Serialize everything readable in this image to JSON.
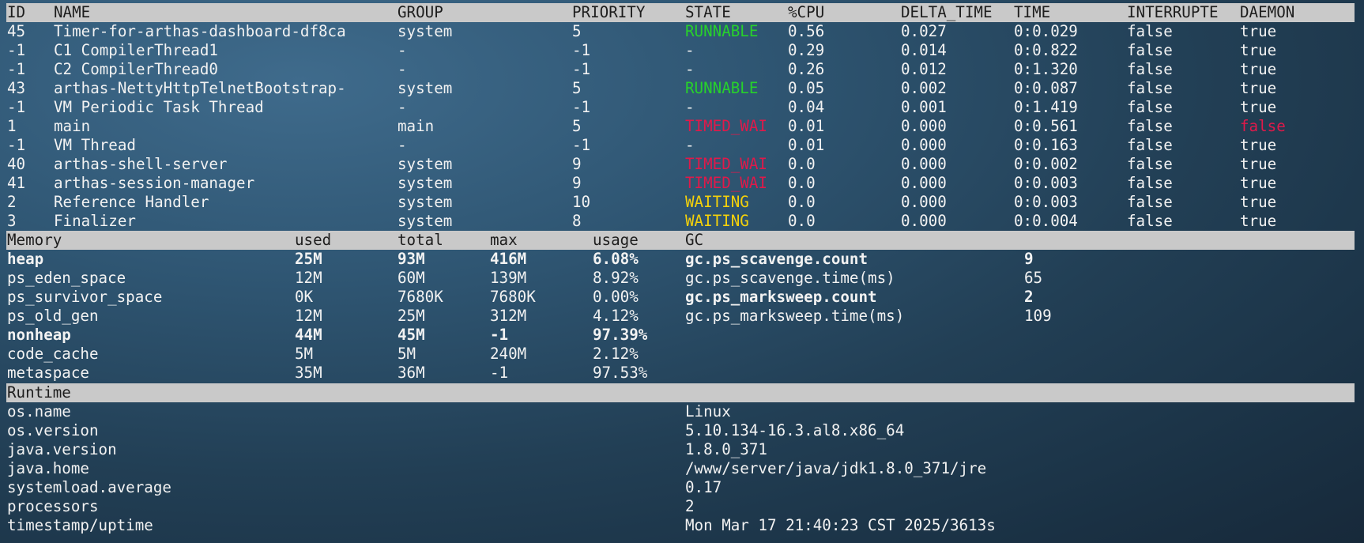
{
  "threads": {
    "headers": {
      "id": "ID",
      "name": "NAME",
      "group": "GROUP",
      "priority": "PRIORITY",
      "state": "STATE",
      "cpu": "%CPU",
      "delta_time": "DELTA_TIME",
      "time": "TIME",
      "interrupted": "INTERRUPTE",
      "daemon": "DAEMON"
    },
    "rows": [
      {
        "id": "45",
        "name": "Timer-for-arthas-dashboard-df8ca",
        "group": "system",
        "priority": "5",
        "state": "RUNNABLE",
        "cpu": "0.56",
        "delta_time": "0.027",
        "time": "0:0.029",
        "interrupted": "false",
        "daemon": "true"
      },
      {
        "id": "-1",
        "name": "C1 CompilerThread1",
        "group": "-",
        "priority": "-1",
        "state": "-",
        "cpu": "0.29",
        "delta_time": "0.014",
        "time": "0:0.822",
        "interrupted": "false",
        "daemon": "true"
      },
      {
        "id": "-1",
        "name": "C2 CompilerThread0",
        "group": "-",
        "priority": "-1",
        "state": "-",
        "cpu": "0.26",
        "delta_time": "0.012",
        "time": "0:1.320",
        "interrupted": "false",
        "daemon": "true"
      },
      {
        "id": "43",
        "name": "arthas-NettyHttpTelnetBootstrap-",
        "group": "system",
        "priority": "5",
        "state": "RUNNABLE",
        "cpu": "0.05",
        "delta_time": "0.002",
        "time": "0:0.087",
        "interrupted": "false",
        "daemon": "true"
      },
      {
        "id": "-1",
        "name": "VM Periodic Task Thread",
        "group": "-",
        "priority": "-1",
        "state": "-",
        "cpu": "0.04",
        "delta_time": "0.001",
        "time": "0:1.419",
        "interrupted": "false",
        "daemon": "true"
      },
      {
        "id": "1",
        "name": "main",
        "group": "main",
        "priority": "5",
        "state": "TIMED_WAI",
        "cpu": "0.01",
        "delta_time": "0.000",
        "time": "0:0.561",
        "interrupted": "false",
        "daemon": "false"
      },
      {
        "id": "-1",
        "name": "VM Thread",
        "group": "-",
        "priority": "-1",
        "state": "-",
        "cpu": "0.01",
        "delta_time": "0.000",
        "time": "0:0.163",
        "interrupted": "false",
        "daemon": "true"
      },
      {
        "id": "40",
        "name": "arthas-shell-server",
        "group": "system",
        "priority": "9",
        "state": "TIMED_WAI",
        "cpu": "0.0",
        "delta_time": "0.000",
        "time": "0:0.002",
        "interrupted": "false",
        "daemon": "true"
      },
      {
        "id": "41",
        "name": "arthas-session-manager",
        "group": "system",
        "priority": "9",
        "state": "TIMED_WAI",
        "cpu": "0.0",
        "delta_time": "0.000",
        "time": "0:0.003",
        "interrupted": "false",
        "daemon": "true"
      },
      {
        "id": "2",
        "name": "Reference Handler",
        "group": "system",
        "priority": "10",
        "state": "WAITING",
        "cpu": "0.0",
        "delta_time": "0.000",
        "time": "0:0.003",
        "interrupted": "false",
        "daemon": "true"
      },
      {
        "id": "3",
        "name": "Finalizer",
        "group": "system",
        "priority": "8",
        "state": "WAITING",
        "cpu": "0.0",
        "delta_time": "0.000",
        "time": "0:0.004",
        "interrupted": "false",
        "daemon": "true"
      }
    ]
  },
  "memory": {
    "headers": {
      "name": "Memory",
      "used": "used",
      "total": "total",
      "max": "max",
      "usage": "usage",
      "gc": "GC"
    },
    "rows": [
      {
        "name": "heap",
        "used": "25M",
        "total": "93M",
        "max": "416M",
        "usage": "6.08%",
        "bold": true
      },
      {
        "name": "ps_eden_space",
        "used": "12M",
        "total": "60M",
        "max": "139M",
        "usage": "8.92%",
        "bold": false
      },
      {
        "name": "ps_survivor_space",
        "used": "0K",
        "total": "7680K",
        "max": "7680K",
        "usage": "0.00%",
        "bold": false
      },
      {
        "name": "ps_old_gen",
        "used": "12M",
        "total": "25M",
        "max": "312M",
        "usage": "4.12%",
        "bold": false
      },
      {
        "name": "nonheap",
        "used": "44M",
        "total": "45M",
        "max": "-1",
        "usage": "97.39%",
        "bold": true
      },
      {
        "name": "code_cache",
        "used": "5M",
        "total": "5M",
        "max": "240M",
        "usage": "2.12%",
        "bold": false
      },
      {
        "name": "metaspace",
        "used": "35M",
        "total": "36M",
        "max": "-1",
        "usage": "97.53%",
        "bold": false
      }
    ],
    "gc": [
      {
        "name": "gc.ps_scavenge.count",
        "value": "9",
        "bold": true
      },
      {
        "name": "gc.ps_scavenge.time(ms)",
        "value": "65",
        "bold": false
      },
      {
        "name": "gc.ps_marksweep.count",
        "value": "2",
        "bold": true
      },
      {
        "name": "gc.ps_marksweep.time(ms)",
        "value": "109",
        "bold": false
      }
    ]
  },
  "runtime": {
    "header": "Runtime",
    "rows": [
      {
        "key": "os.name",
        "value": "Linux"
      },
      {
        "key": "os.version",
        "value": "5.10.134-16.3.al8.x86_64"
      },
      {
        "key": "java.version",
        "value": "1.8.0_371"
      },
      {
        "key": "java.home",
        "value": "/www/server/java/jdk1.8.0_371/jre"
      },
      {
        "key": "systemload.average",
        "value": "0.17"
      },
      {
        "key": "processors",
        "value": "2"
      },
      {
        "key": "timestamp/uptime",
        "value": "Mon Mar 17 21:40:23 CST 2025/3613s"
      }
    ]
  },
  "colors": {
    "runnable": "#27d12b",
    "timed_waiting": "#e0194a",
    "waiting": "#f5d10a",
    "daemon_false": "#e0194a",
    "header_bg": "#c9c9c9"
  }
}
